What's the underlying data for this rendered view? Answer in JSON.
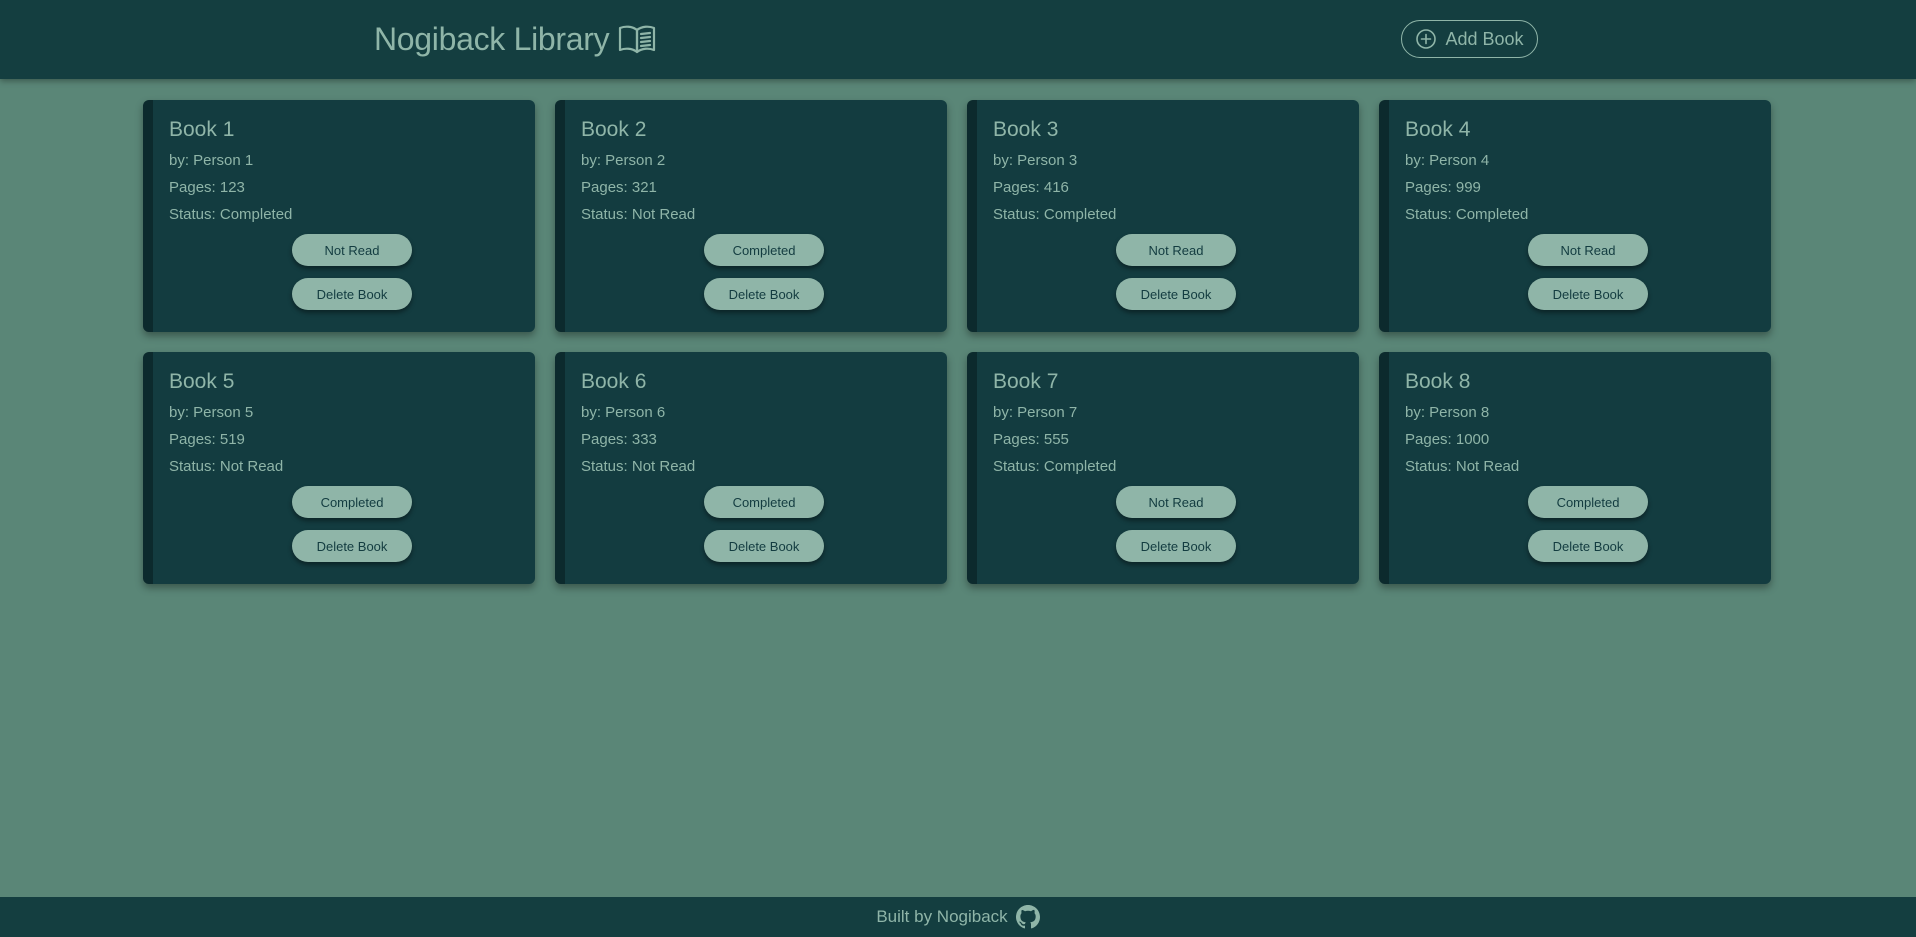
{
  "header": {
    "title": "Nogiback Library",
    "brand_icon": "open-book-icon",
    "add_book_label": "Add Book",
    "add_book_icon": "plus-circle-icon"
  },
  "colors": {
    "page_background": "#5a8677",
    "header_background": "#143e40",
    "card_background": "#133c40",
    "card_spine": "#0c2a2d",
    "accent": "#8fb5a8"
  },
  "books": [
    {
      "title": "Book 1",
      "author": "by: Person 1",
      "pages": "Pages: 123",
      "status": "Status: Completed",
      "toggle_label": "Not Read",
      "delete_label": "Delete Book"
    },
    {
      "title": "Book 2",
      "author": "by: Person 2",
      "pages": "Pages: 321",
      "status": "Status: Not Read",
      "toggle_label": "Completed",
      "delete_label": "Delete Book"
    },
    {
      "title": "Book 3",
      "author": "by: Person 3",
      "pages": "Pages: 416",
      "status": "Status: Completed",
      "toggle_label": "Not Read",
      "delete_label": "Delete Book"
    },
    {
      "title": "Book 4",
      "author": "by: Person 4",
      "pages": "Pages: 999",
      "status": "Status: Completed",
      "toggle_label": "Not Read",
      "delete_label": "Delete Book"
    },
    {
      "title": "Book 5",
      "author": "by: Person 5",
      "pages": "Pages: 519",
      "status": "Status: Not Read",
      "toggle_label": "Completed",
      "delete_label": "Delete Book"
    },
    {
      "title": "Book 6",
      "author": "by: Person 6",
      "pages": "Pages: 333",
      "status": "Status: Not Read",
      "toggle_label": "Completed",
      "delete_label": "Delete Book"
    },
    {
      "title": "Book 7",
      "author": "by: Person 7",
      "pages": "Pages: 555",
      "status": "Status: Completed",
      "toggle_label": "Not Read",
      "delete_label": "Delete Book"
    },
    {
      "title": "Book 8",
      "author": "by: Person 8",
      "pages": "Pages: 1000",
      "status": "Status: Not Read",
      "toggle_label": "Completed",
      "delete_label": "Delete Book"
    }
  ],
  "footer": {
    "text": "Built by Nogiback",
    "icon": "github-icon"
  }
}
